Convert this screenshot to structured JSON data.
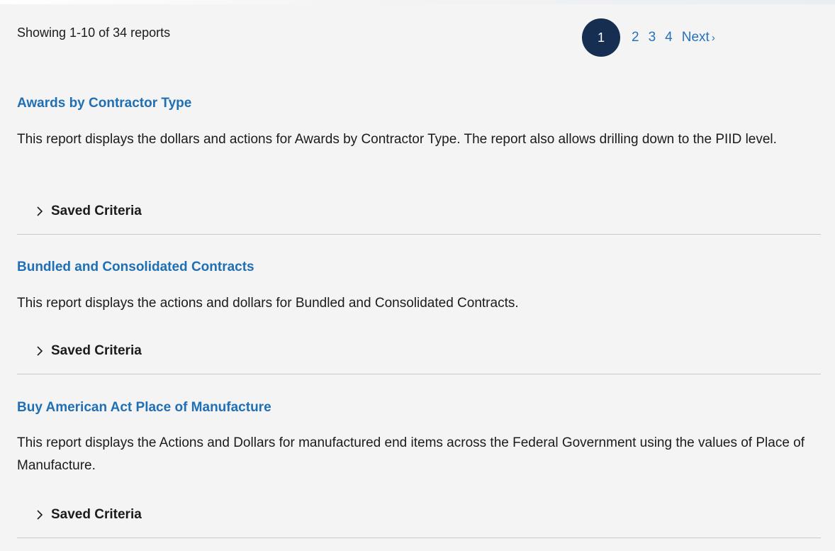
{
  "results": {
    "count_text": "Showing 1-10 of 34 reports"
  },
  "pagination": {
    "current": "1",
    "pages": [
      "2",
      "3",
      "4"
    ],
    "next_label": "Next",
    "next_chevron": "›"
  },
  "reports": [
    {
      "title": "Awards by Contractor Type",
      "description": "This report displays the dollars and actions for Awards by Contractor Type. The report also allows drilling down to the PIID level.",
      "criteria_label": "Saved Criteria"
    },
    {
      "title": "Bundled and Consolidated Contracts",
      "description": "This report displays the actions and dollars for Bundled and Consolidated Contracts.",
      "criteria_label": "Saved Criteria"
    },
    {
      "title": "Buy American Act Place of Manufacture",
      "description": "This report displays the Actions and Dollars for manufactured end items across the Federal Government using the values of Place of Manufacture.",
      "criteria_label": "Saved Criteria"
    }
  ],
  "colors": {
    "link": "#1f6fb5",
    "current_page_bg": "#162e51",
    "background": "#f4f4f4",
    "divider": "#c9c9c9"
  }
}
